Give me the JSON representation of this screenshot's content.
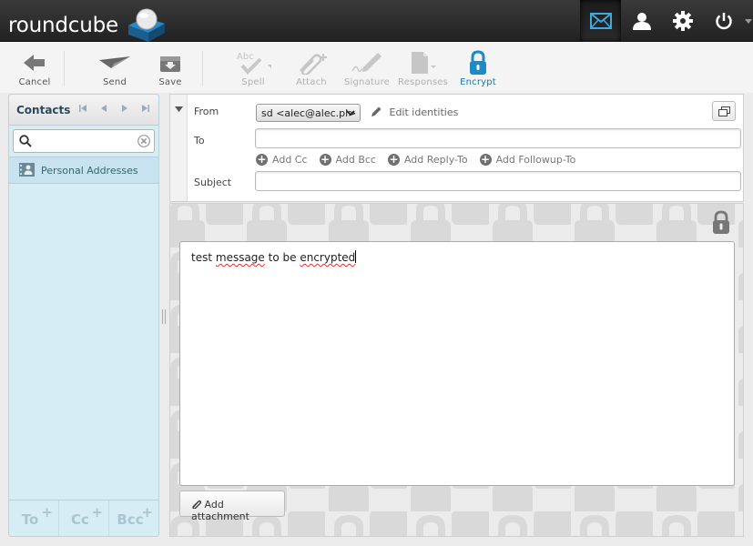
{
  "app": {
    "logo_text": "roundcube"
  },
  "topnav": [
    {
      "id": "mail",
      "icon": "envelope-icon",
      "active": true
    },
    {
      "id": "contacts",
      "icon": "user-icon",
      "active": false
    },
    {
      "id": "settings",
      "icon": "gear-icon",
      "active": false
    },
    {
      "id": "logout",
      "icon": "power-icon",
      "active": false
    }
  ],
  "toolbar": {
    "cancel": "Cancel",
    "send": "Send",
    "save": "Save",
    "spell": "Spell",
    "attach": "Attach",
    "signature": "Signature",
    "responses": "Responses",
    "encrypt": "Encrypt"
  },
  "contacts": {
    "title": "Contacts",
    "search_value": "",
    "address_book": "Personal Addresses",
    "footer": {
      "to": "To",
      "cc": "Cc",
      "bcc": "Bcc",
      "plus": "+"
    }
  },
  "compose": {
    "from_label": "From",
    "from_value": "sd <alec@alec.pl>",
    "edit_identities": "Edit identities",
    "to_label": "To",
    "to_value": "",
    "add_cc": "Add Cc",
    "add_bcc": "Add Bcc",
    "add_reply_to": "Add Reply-To",
    "add_followup_to": "Add Followup-To",
    "subject_label": "Subject",
    "subject_value": "",
    "body_words": [
      "test",
      "message",
      "to",
      "be",
      "encrypted"
    ],
    "add_attachment": "Add attachment"
  },
  "colors": {
    "accent": "#1978a8",
    "contacts_bg": "#d7edf5",
    "topbar": "#2a2a2a"
  }
}
